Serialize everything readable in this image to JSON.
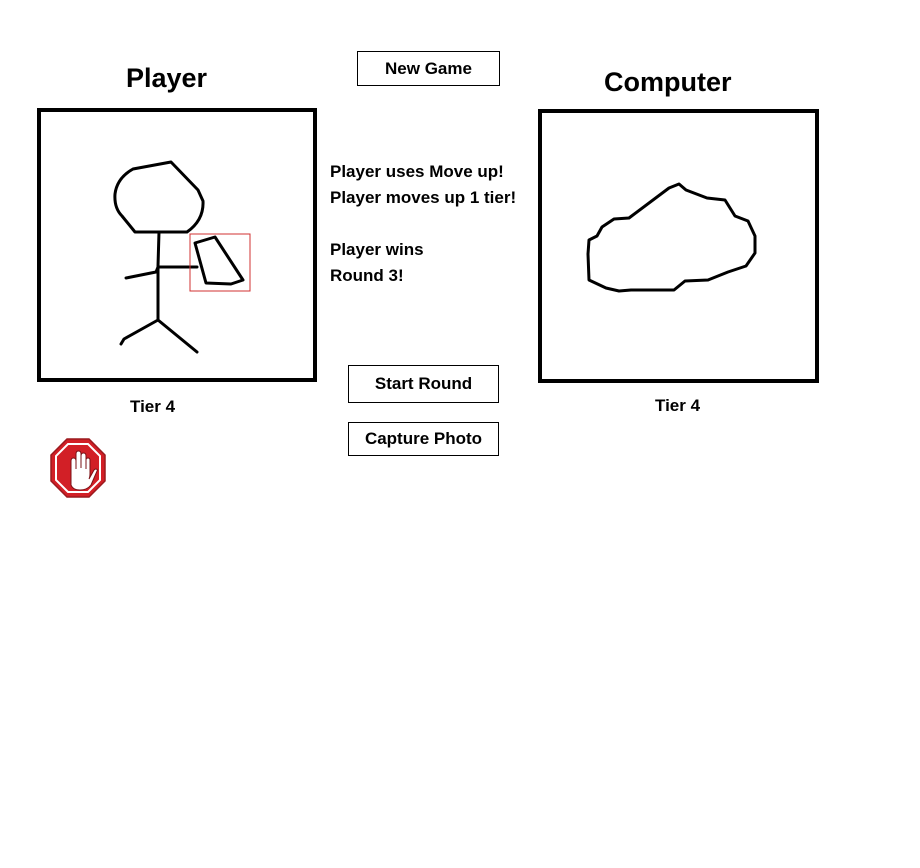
{
  "player": {
    "title": "Player",
    "tier": "Tier 4",
    "drawing": "stick-figure-holding-paper"
  },
  "computer": {
    "title": "Computer",
    "tier": "Tier 4",
    "drawing": "rock"
  },
  "controls": {
    "new_game": "New Game",
    "start_round": "Start Round",
    "capture_photo": "Capture Photo",
    "stop_icon": "stop-hand-icon"
  },
  "messages": {
    "line1": "Player uses Move up!",
    "line2": "Player moves up 1 tier!",
    "line3": "Player wins",
    "line4": "Round 3!"
  },
  "colors": {
    "frame": "#000000",
    "detection_box": "#d03030",
    "stop_red": "#d21f26"
  }
}
